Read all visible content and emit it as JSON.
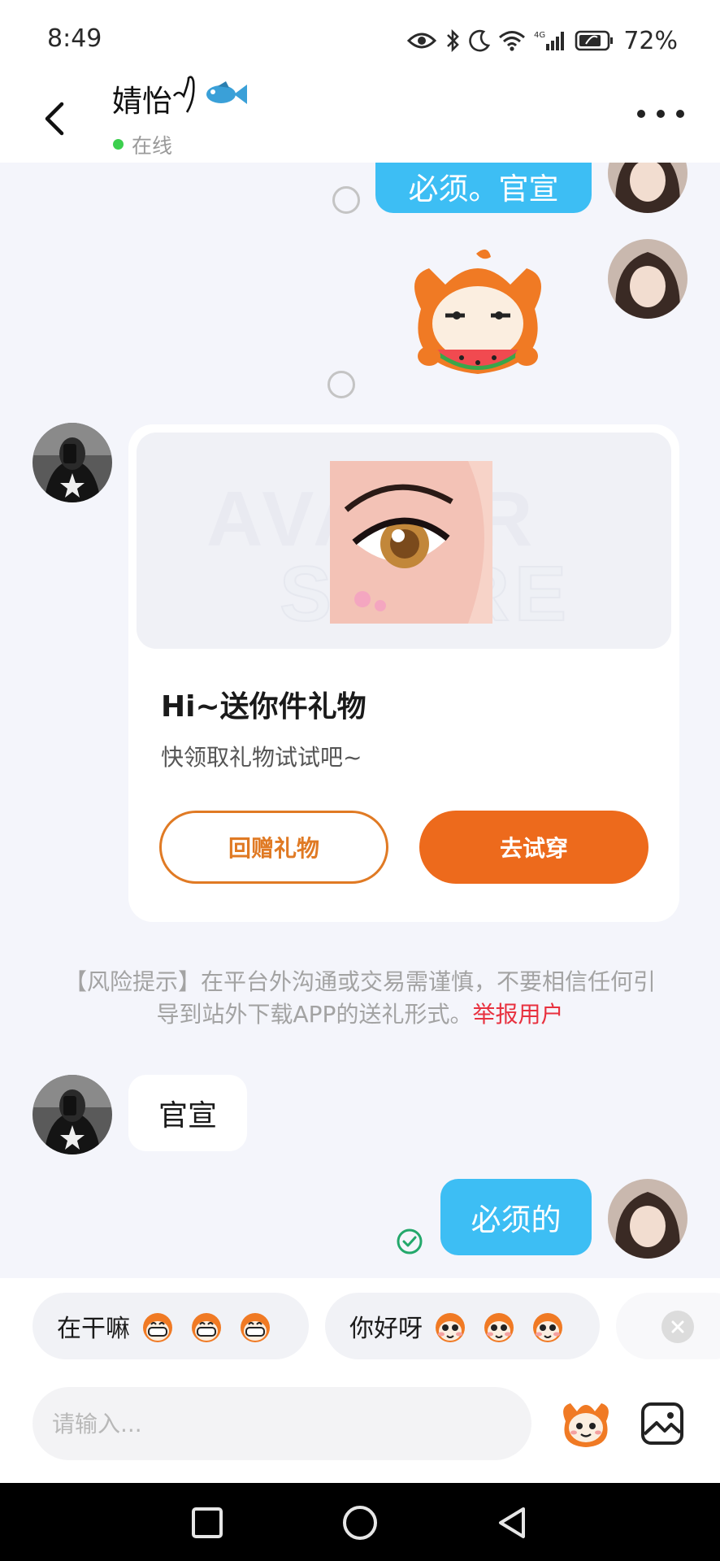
{
  "status_bar": {
    "time": "8:49",
    "battery_percent": "72%",
    "icons": [
      "eye-icon",
      "bluetooth-icon",
      "moon-icon",
      "wifi-icon",
      "4g-signal-icon",
      "battery-icon"
    ]
  },
  "header": {
    "contact_name": "婧怡",
    "online_status": "在线",
    "back_icon": "chevron-left-icon",
    "more_icon": "more-dots-icon"
  },
  "messages": [
    {
      "from": "me",
      "type": "text",
      "text": "必须。官宣"
    },
    {
      "from": "me",
      "type": "sticker",
      "sticker": "watermelon-mascot-sticker"
    },
    {
      "from": "them",
      "type": "gift_card",
      "watermark": [
        "AVATAR",
        "STORE"
      ],
      "title": "Hi~送你件礼物",
      "subtitle": "快领取礼物试试吧~",
      "button_return": "回赠礼物",
      "button_try": "去试穿"
    },
    {
      "from": "system",
      "type": "notice",
      "text": "【风险提示】在平台外沟通或交易需谨慎，不要相信任何引导到站外下载APP的送礼形式。",
      "link_text": "举报用户"
    },
    {
      "from": "them",
      "type": "text",
      "text": "官宣"
    },
    {
      "from": "me",
      "type": "text",
      "text": "必须的"
    }
  ],
  "quick_replies": [
    {
      "text": "在干嘛",
      "emoji": "grin-mascot-emoji"
    },
    {
      "text": "你好呀",
      "emoji": "blush-mascot-emoji"
    }
  ],
  "input": {
    "placeholder": "请输入...",
    "value": "",
    "emoji_button_icon": "mascot-emoji-icon",
    "image_button_icon": "image-icon"
  },
  "nav": [
    "recents-square-icon",
    "home-circle-icon",
    "back-triangle-icon"
  ],
  "colors": {
    "my_bubble": "#3dbef4",
    "accent_orange": "#ed6a1c",
    "report_red": "#e8313f",
    "online_green": "#3ccf4e",
    "background": "#f4f5fb"
  }
}
